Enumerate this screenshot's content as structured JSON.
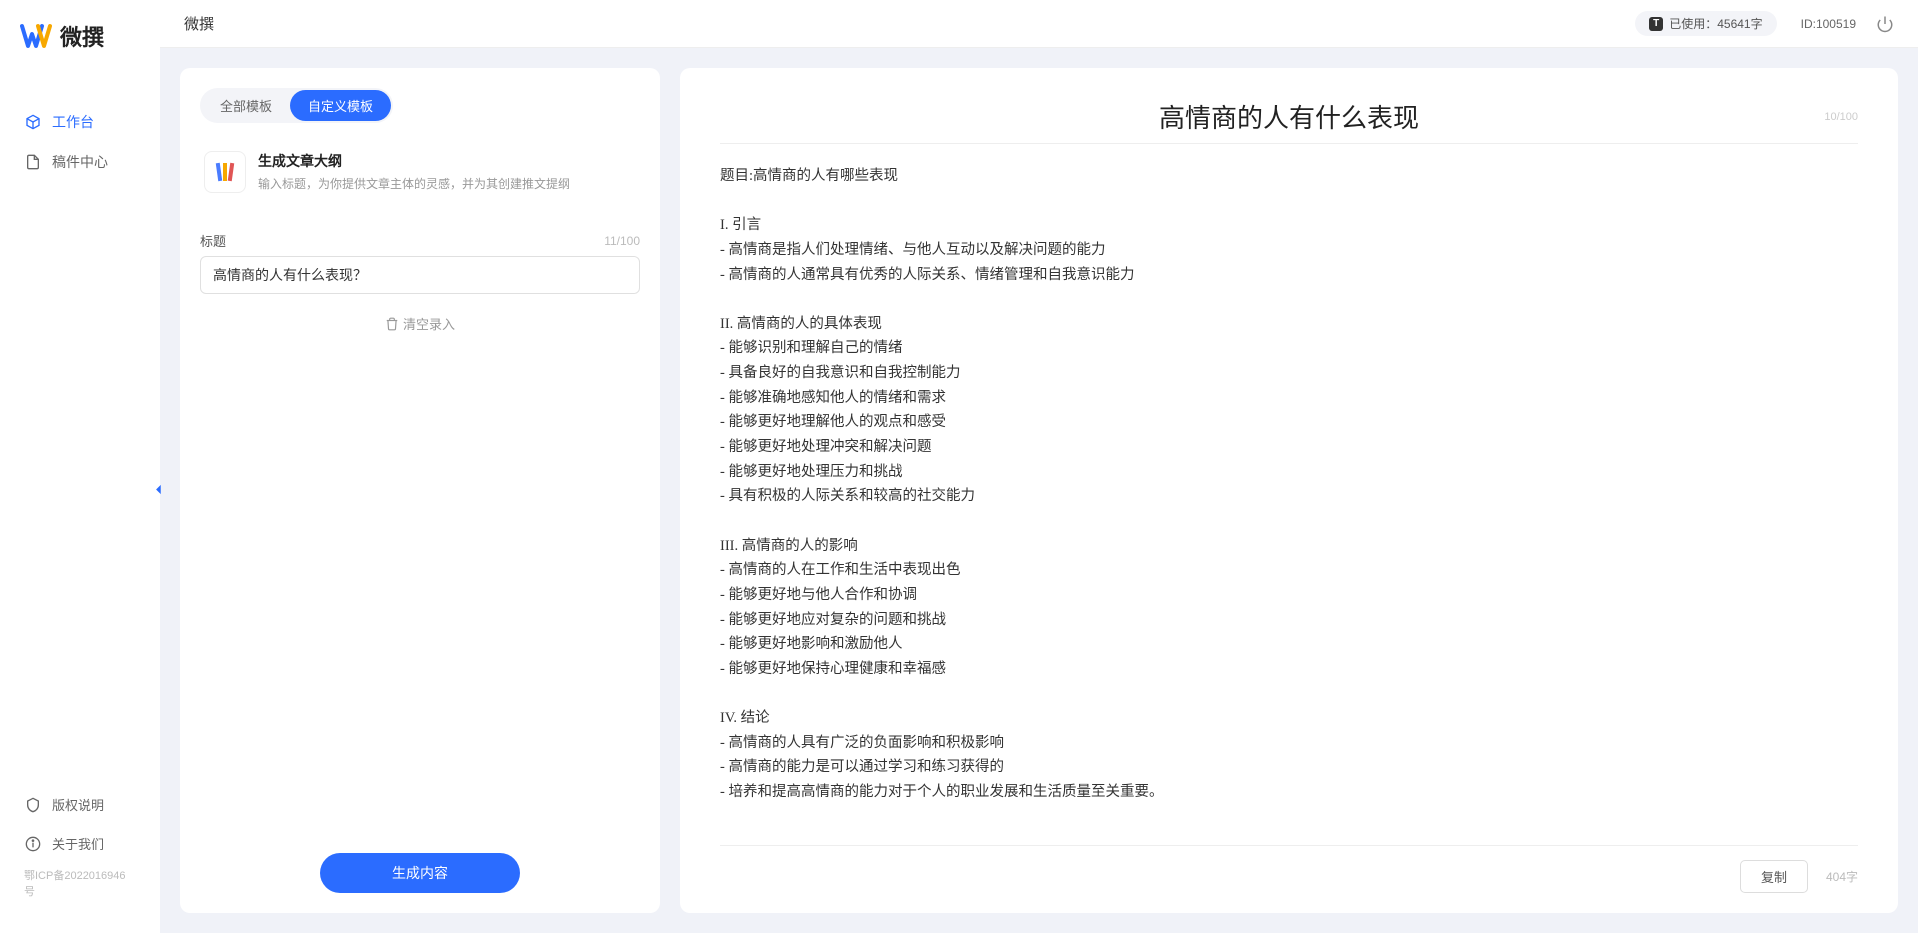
{
  "brand": {
    "name": "微撰"
  },
  "nav": {
    "workspace": "工作台",
    "drafts": "稿件中心",
    "copyright": "版权说明",
    "about": "关于我们",
    "icp": "鄂ICP备2022016946号"
  },
  "topbar": {
    "title": "微撰",
    "usage_label": "已使用：",
    "usage_value": "45641字",
    "user_id_label": "ID:",
    "user_id": "100519"
  },
  "left": {
    "tabs": {
      "all": "全部模板",
      "custom": "自定义模板"
    },
    "template": {
      "name": "生成文章大纲",
      "desc": "输入标题，为你提供文章主体的灵感，并为其创建推文提纲"
    },
    "form": {
      "label": "标题",
      "counter": "11/100",
      "value": "高情商的人有什么表现？"
    },
    "clear": "清空录入",
    "generate": "生成内容"
  },
  "output": {
    "title": "高情商的人有什么表现",
    "title_counter": "10/100",
    "body": "题目:高情商的人有哪些表现\n\nI. 引言\n- 高情商是指人们处理情绪、与他人互动以及解决问题的能力\n- 高情商的人通常具有优秀的人际关系、情绪管理和自我意识能力\n\nII. 高情商的人的具体表现\n- 能够识别和理解自己的情绪\n- 具备良好的自我意识和自我控制能力\n- 能够准确地感知他人的情绪和需求\n- 能够更好地理解他人的观点和感受\n- 能够更好地处理冲突和解决问题\n- 能够更好地处理压力和挑战\n- 具有积极的人际关系和较高的社交能力\n\nIII. 高情商的人的影响\n- 高情商的人在工作和生活中表现出色\n- 能够更好地与他人合作和协调\n- 能够更好地应对复杂的问题和挑战\n- 能够更好地影响和激励他人\n- 能够更好地保持心理健康和幸福感\n\nIV. 结论\n- 高情商的人具有广泛的负面影响和积极影响\n- 高情商的能力是可以通过学习和练习获得的\n- 培养和提高高情商的能力对于个人的职业发展和生活质量至关重要。",
    "copy": "复制",
    "word_count": "404字"
  }
}
